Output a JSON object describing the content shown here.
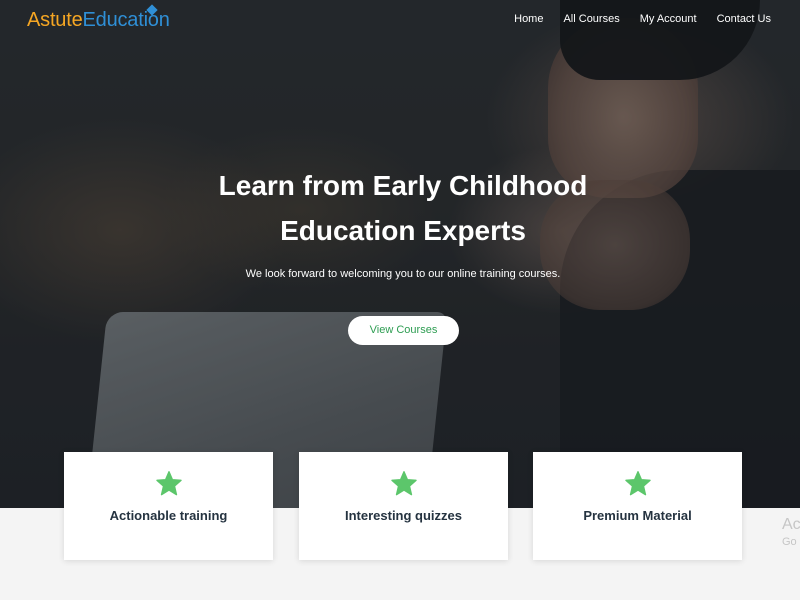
{
  "logo": {
    "part1": "Astute",
    "part2": "Education"
  },
  "nav": {
    "items": [
      "Home",
      "All Courses",
      "My Account",
      "Contact Us"
    ]
  },
  "hero": {
    "headline_line1": "Learn from Early Childhood",
    "headline_line2": "Education Experts",
    "subtext": "We look forward to welcoming you to our online training courses.",
    "cta_label": "View Courses"
  },
  "features": [
    {
      "icon": "star-icon",
      "label": "Actionable training"
    },
    {
      "icon": "star-icon",
      "label": "Interesting quizzes"
    },
    {
      "icon": "star-icon",
      "label": "Premium Material"
    }
  ],
  "peek": {
    "line1": "Ac",
    "line2": "Go"
  },
  "colors": {
    "logo_orange": "#f5a623",
    "logo_blue": "#2f8fd6",
    "accent_green": "#2e9d52",
    "star_green": "#5cc66b",
    "card_text": "#253340"
  }
}
